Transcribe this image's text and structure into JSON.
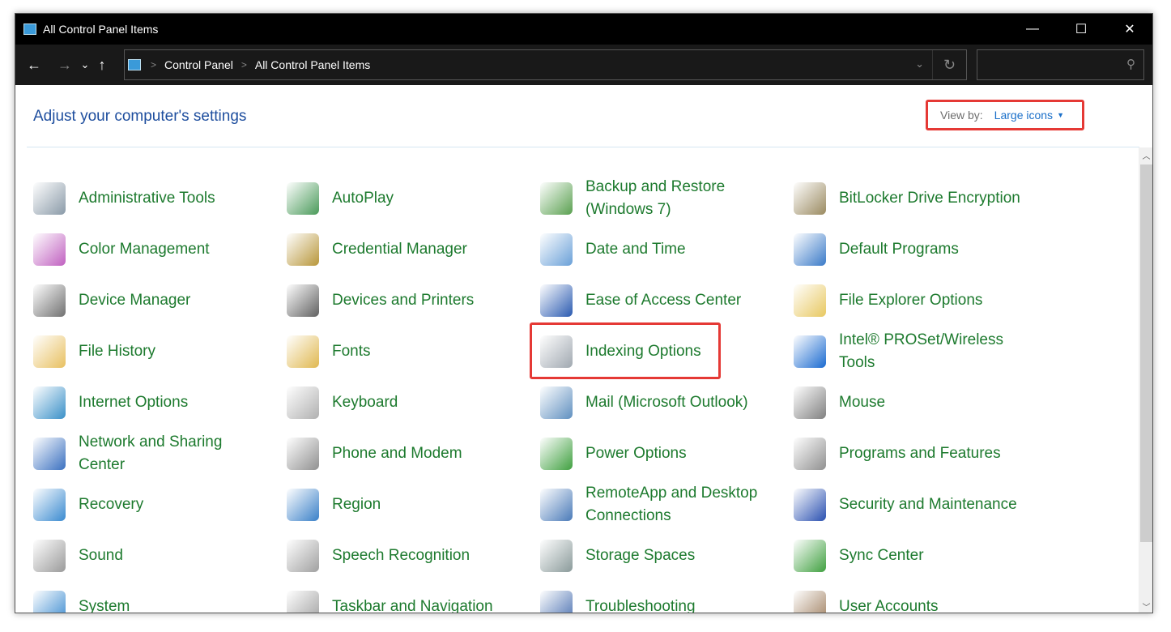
{
  "window": {
    "title": "All Control Panel Items",
    "minimize": "—",
    "maximize": "☐",
    "close": "✕"
  },
  "address": {
    "back": "←",
    "forward": "→",
    "recent": "⌄",
    "up": "↑",
    "crumbs": [
      "Control Panel",
      "All Control Panel Items"
    ],
    "separator": ">",
    "dropdown": "⌄",
    "refresh": "↻",
    "search_placeholder": "",
    "search_icon": "⚲"
  },
  "header": {
    "title": "Adjust your computer's settings",
    "view_by_label": "View by:",
    "view_by_value": "Large icons",
    "caret": "▼"
  },
  "items": [
    {
      "label": "Administrative Tools",
      "color": "#8a9aa8"
    },
    {
      "label": "AutoPlay",
      "color": "#4a9a5a"
    },
    {
      "label": "Backup and Restore (Windows 7)",
      "color": "#5aa050"
    },
    {
      "label": "BitLocker Drive Encryption",
      "color": "#9a8a60"
    },
    {
      "label": "Color Management",
      "color": "#c060c0"
    },
    {
      "label": "Credential Manager",
      "color": "#b8963a"
    },
    {
      "label": "Date and Time",
      "color": "#6aa0d8"
    },
    {
      "label": "Default Programs",
      "color": "#3a7ac8"
    },
    {
      "label": "Device Manager",
      "color": "#707070"
    },
    {
      "label": "Devices and Printers",
      "color": "#606060"
    },
    {
      "label": "Ease of Access Center",
      "color": "#2a5ab0"
    },
    {
      "label": "File Explorer Options",
      "color": "#e8c860"
    },
    {
      "label": "File History",
      "color": "#e8c060"
    },
    {
      "label": "Fonts",
      "color": "#e0b850"
    },
    {
      "label": "Indexing Options",
      "color": "#a0a8b0",
      "highlighted": true
    },
    {
      "label": "Intel® PROSet/Wireless Tools",
      "color": "#1a6ad0"
    },
    {
      "label": "Internet Options",
      "color": "#3a90c8"
    },
    {
      "label": "Keyboard",
      "color": "#b0b0b0"
    },
    {
      "label": "Mail (Microsoft Outlook)",
      "color": "#6090c0"
    },
    {
      "label": "Mouse",
      "color": "#808080"
    },
    {
      "label": "Network and Sharing Center",
      "color": "#3a70c0"
    },
    {
      "label": "Phone and Modem",
      "color": "#909090"
    },
    {
      "label": "Power Options",
      "color": "#40a040"
    },
    {
      "label": "Programs and Features",
      "color": "#909090"
    },
    {
      "label": "Recovery",
      "color": "#3a8ad0"
    },
    {
      "label": "Region",
      "color": "#3a80c8"
    },
    {
      "label": "RemoteApp and Desktop Connections",
      "color": "#4a7ab8"
    },
    {
      "label": "Security and Maintenance",
      "color": "#2a50b0"
    },
    {
      "label": "Sound",
      "color": "#9a9a9a"
    },
    {
      "label": "Speech Recognition",
      "color": "#a0a0a0"
    },
    {
      "label": "Storage Spaces",
      "color": "#8a9a9a"
    },
    {
      "label": "Sync Center",
      "color": "#40a040"
    },
    {
      "label": "System",
      "color": "#3a8ad0"
    },
    {
      "label": "Taskbar and Navigation",
      "color": "#a0a0a0"
    },
    {
      "label": "Troubleshooting",
      "color": "#4a70b0"
    },
    {
      "label": "User Accounts",
      "color": "#a08060"
    }
  ],
  "scrollbar": {
    "up": "︿",
    "down": "﹀"
  }
}
